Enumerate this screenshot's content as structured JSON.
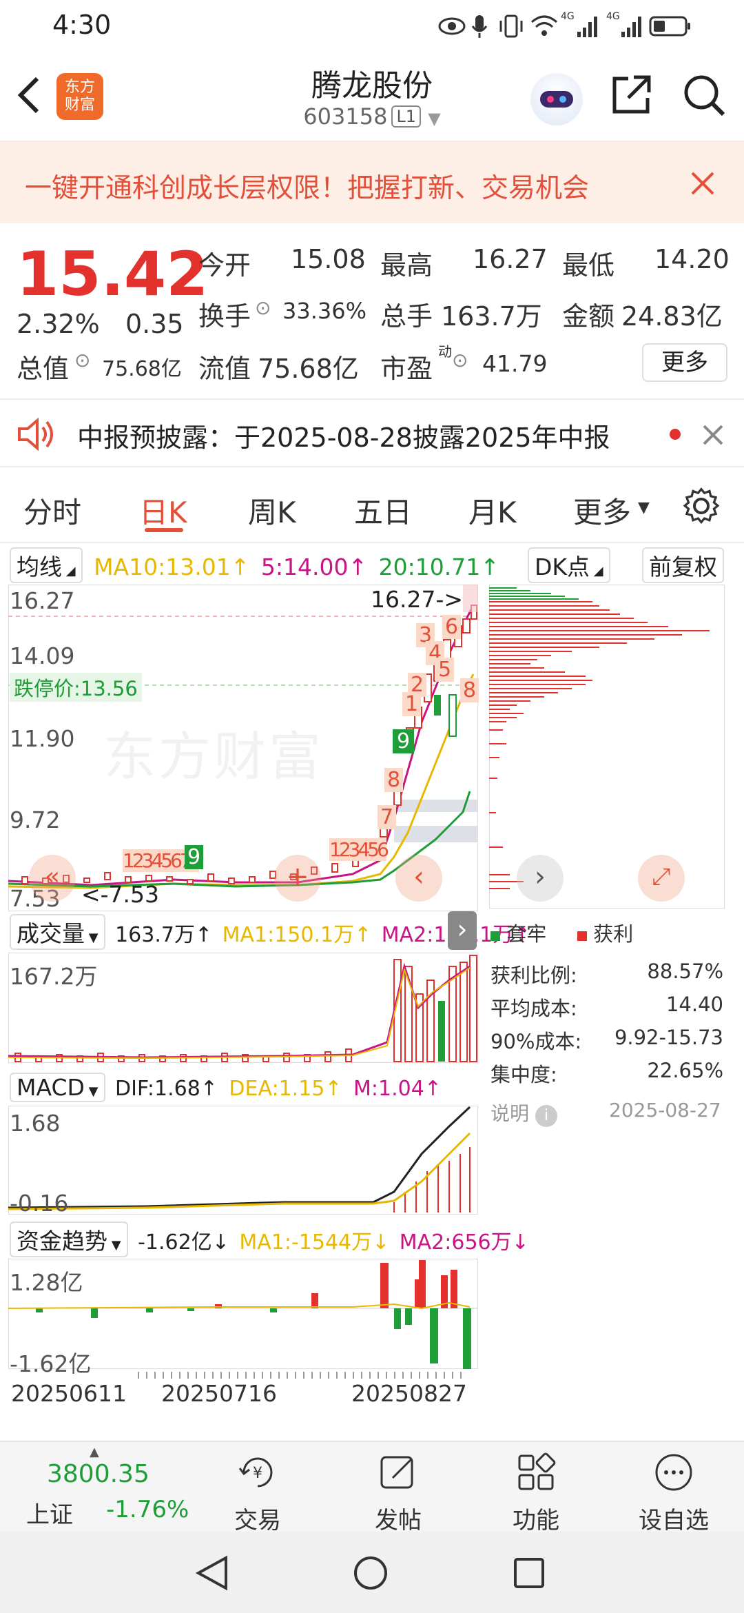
{
  "status": {
    "time": "4:30",
    "signal1": "4G",
    "signal2": "4G"
  },
  "header": {
    "app_logo": "东方财富",
    "stock_name": "腾龙股份",
    "stock_code": "603158",
    "level": "L1"
  },
  "banner": {
    "text": "一键开通科创成长层权限！把握打新、交易机会"
  },
  "quote": {
    "price": "15.42",
    "change_pct": "2.32%",
    "change": "0.35",
    "open_label": "今开",
    "open": "15.08",
    "high_label": "最高",
    "high": "16.27",
    "low_label": "最低",
    "low": "14.20",
    "turnover_label": "换手",
    "turnover": "33.36%",
    "volume_label": "总手",
    "volume": "163.7万",
    "amount_label": "金额",
    "amount": "24.83亿",
    "total_value_label": "总值",
    "total_value": "75.68亿",
    "float_value_label": "流值",
    "float_value": "75.68亿",
    "pe_label": "市盈",
    "pe_sup": "动",
    "pe": "41.79",
    "more": "更多"
  },
  "notice": {
    "text": "中报预披露：于2025-08-28披露2025年中报"
  },
  "tabs": [
    "分时",
    "日K",
    "周K",
    "五日",
    "月K",
    "更多"
  ],
  "active_tab": 1,
  "ma": {
    "selector": "均线",
    "ma10": "MA10:13.01↑",
    "ma5": "5:14.00↑",
    "ma20": "20:10.71↑",
    "dk": "DK点",
    "adjust": "前复权"
  },
  "kline": {
    "y_labels": [
      "16.27",
      "14.09",
      "11.90",
      "9.72",
      "7.53"
    ],
    "limit_down": "跌停价:13.56",
    "high_marker": "16.27->",
    "low_marker": "<-7.53",
    "watermark": "东方财富",
    "num_labels_top": [
      "3",
      "6",
      "4",
      "5",
      "2",
      "8",
      "1"
    ],
    "num_label_green": "9",
    "num_labels_mid": [
      "8",
      "7"
    ],
    "seq_left": "12345678",
    "seq_left_green": "9",
    "seq_mid": "123456"
  },
  "volume": {
    "selector": "成交量",
    "value": "163.7万↑",
    "ma1": "MA1:150.1万↑",
    "ma2": "MA2:150.1万↑",
    "y_top": "167.2万"
  },
  "macd": {
    "selector": "MACD",
    "dif": "DIF:1.68↑",
    "dea": "DEA:1.15↑",
    "m": "M:1.04↑",
    "y_top": "1.68",
    "y_bottom": "-0.16"
  },
  "fund": {
    "selector": "资金趋势",
    "value": "-1.62亿↓",
    "ma1": "MA1:-1544万↓",
    "ma2": "MA2:656万↓",
    "y_top": "1.28亿",
    "y_bottom": "-1.62亿"
  },
  "dates": [
    "20250611",
    "20250716",
    "20250827"
  ],
  "chips": {
    "legend_trapped": "套牢",
    "legend_profit": "获利",
    "rows": [
      {
        "label": "获利比例:",
        "value": "88.57%"
      },
      {
        "label": "平均成本:",
        "value": "14.40"
      },
      {
        "label": "90%成本:",
        "value": "9.92-15.73"
      },
      {
        "label": "集中度:",
        "value": "22.65%"
      }
    ],
    "note": "说明",
    "date": "2025-08-27"
  },
  "bottom": {
    "index_value": "3800.35",
    "index_name": "上证",
    "index_change": "-1.76%",
    "nav": [
      "交易",
      "发帖",
      "功能",
      "设自选"
    ]
  },
  "colors": {
    "red": "#e3312d",
    "green": "#1e9d38",
    "orange": "#e3503a",
    "magenta": "#c71585",
    "yellow": "#e8b800"
  }
}
